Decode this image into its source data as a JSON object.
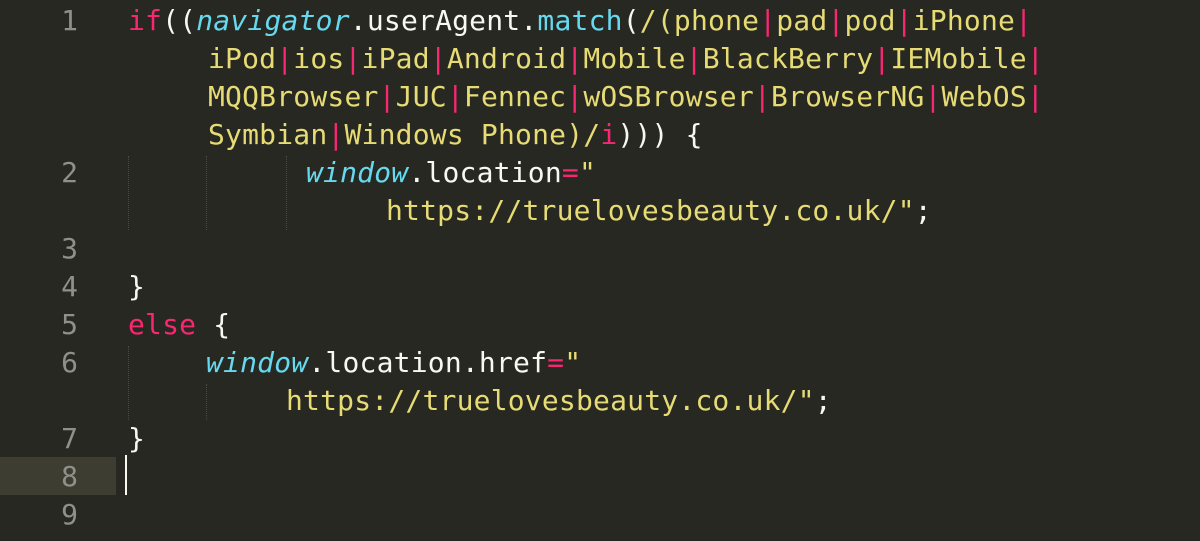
{
  "editor": {
    "theme_colors": {
      "background": "#272822",
      "gutter_text": "#90908a",
      "keyword": "#f92672",
      "builtin": "#66d9ef",
      "string": "#e6db74",
      "plain": "#f8f8f2"
    },
    "line_numbers": [
      "1",
      "2",
      "3",
      "4",
      "5",
      "6",
      "7",
      "8",
      "9"
    ],
    "active_line": "8",
    "code": {
      "l1a_kw": "if",
      "l1a_p1": "((",
      "l1a_obj": "navigator",
      "l1a_p2": ".userAgent.",
      "l1a_fn": "match",
      "l1a_p3": "(",
      "l1a_rx1": "/(phone",
      "l1a_rx2": "pad",
      "l1a_rx3": "pod",
      "l1a_rx4": "iPhone",
      "l1b_rx1": "iPod",
      "l1b_rx2": "ios",
      "l1b_rx3": "iPad",
      "l1b_rx4": "Android",
      "l1b_rx5": "Mobile",
      "l1b_rx6": "BlackBerry",
      "l1b_rx7": "IEMobile",
      "l1c_rx1": "MQQBrowser",
      "l1c_rx2": "JUC",
      "l1c_rx3": "Fennec",
      "l1c_rx4": "wOSBrowser",
      "l1c_rx5": "BrowserNG",
      "l1c_rx6": "WebOS",
      "l1d_rx1": "Symbian",
      "l1d_rx2": "Windows Phone)/",
      "l1d_flag": "i",
      "l1d_end": "))) {",
      "pipe": "|",
      "l2a_obj": "window",
      "l2a_prop": ".location",
      "l2a_eq": "=",
      "l2a_q": "\"",
      "l2b_url": "https://truelovesbeauty.co.uk/\"",
      "l2b_semi": ";",
      "l4_brace": "}",
      "l5_kw": "else",
      "l5_brace": " {",
      "l6a_obj": "window",
      "l6a_prop": ".location.href",
      "l6a_eq": "=",
      "l6a_q": "\"",
      "l6b_url": "https://truelovesbeauty.co.uk/\"",
      "l6b_semi": ";",
      "l7_brace": "}"
    }
  }
}
